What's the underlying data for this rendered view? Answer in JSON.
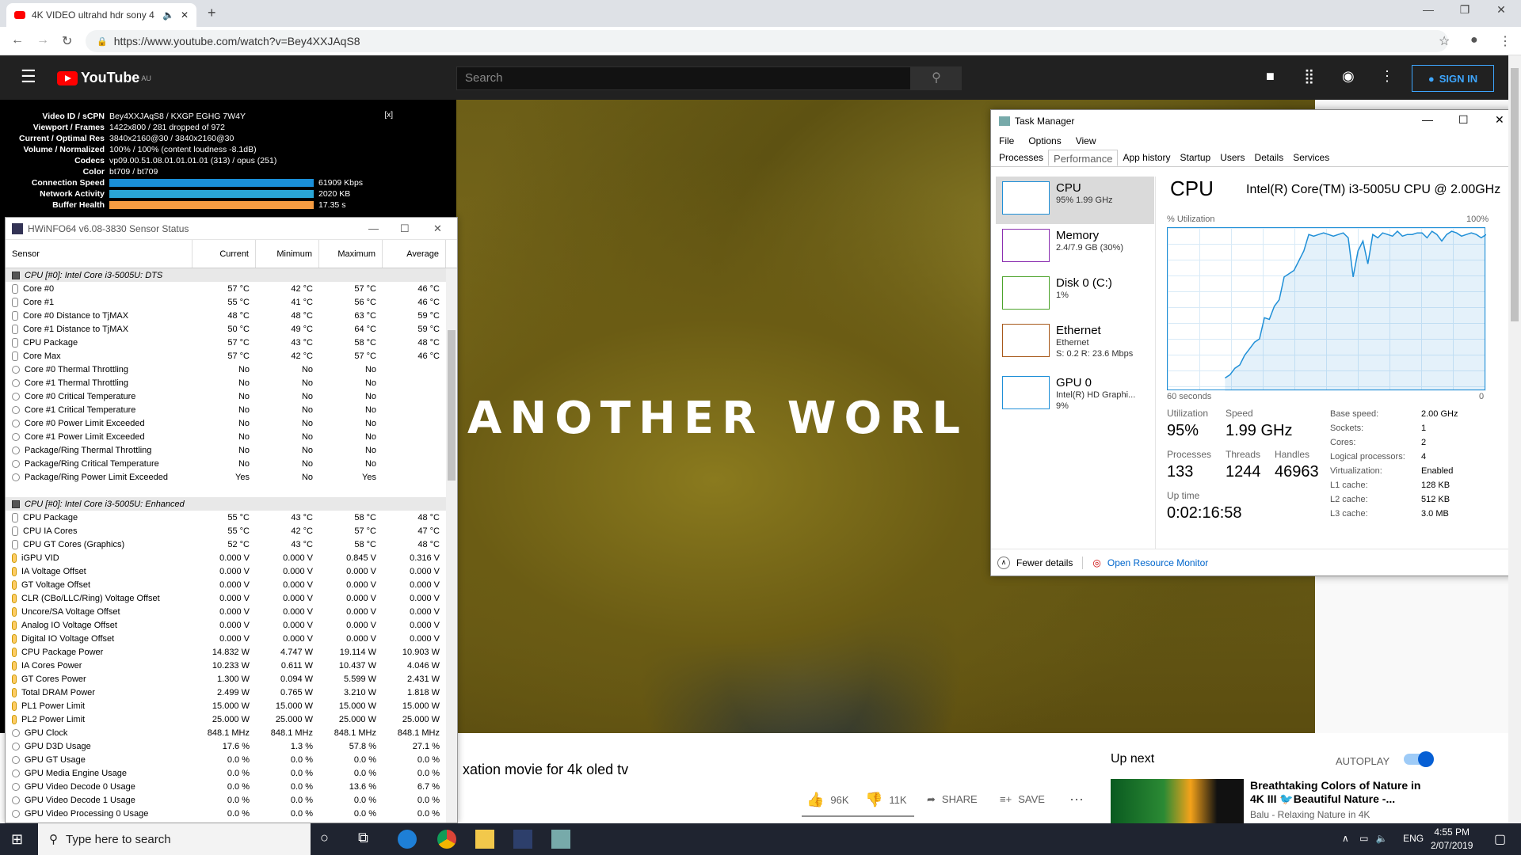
{
  "browser": {
    "tab_title": "4K VIDEO ultrahd hdr sony 4",
    "url": "https://www.youtube.com/watch?v=Bey4XXJAqS8"
  },
  "youtube": {
    "logo": "YouTube",
    "region": "AU",
    "search_placeholder": "Search",
    "sign_in": "SIGN IN",
    "video_overlay_text": "ANOTHER WORL",
    "video_title_visible": "xation movie for 4k oled tv",
    "likes": "96K",
    "dislikes": "11K",
    "share": "SHARE",
    "save": "SAVE",
    "up_next": "Up next",
    "autoplay": "AUTOPLAY",
    "next_title": "Breathtaking Colors of Nature in 4K III 🐦Beautiful Nature -...",
    "next_channel": "Balu - Relaxing Nature in 4K"
  },
  "stats": {
    "close": "[x]",
    "rows": [
      {
        "k": "Video ID / sCPN",
        "v": "Bey4XXJAqS8 / KXGP EGHG 7W4Y"
      },
      {
        "k": "Viewport / Frames",
        "v": "1422x800 / 281 dropped of 972"
      },
      {
        "k": "Current / Optimal Res",
        "v": "3840x2160@30 / 3840x2160@30"
      },
      {
        "k": "Volume / Normalized",
        "v": "100% / 100% (content loudness -8.1dB)"
      },
      {
        "k": "Codecs",
        "v": "vp09.00.51.08.01.01.01.01 (313) / opus (251)"
      },
      {
        "k": "Color",
        "v": "bt709 / bt709"
      }
    ],
    "bars": [
      {
        "k": "Connection Speed",
        "v": "61909 Kbps",
        "color": "#1a8fd8"
      },
      {
        "k": "Network Activity",
        "v": "2020 KB",
        "color": "#2aa6d6"
      },
      {
        "k": "Buffer Health",
        "v": "17.35 s",
        "color": "#f59c42"
      }
    ]
  },
  "hwinfo": {
    "title": "HWiNFO64 v6.08-3830 Sensor Status",
    "headers": [
      "Sensor",
      "Current",
      "Minimum",
      "Maximum",
      "Average"
    ],
    "rows": [
      {
        "t": "grp",
        "n": "CPU [#0]: Intel Core i3-5005U: DTS"
      },
      {
        "t": "temp",
        "n": "Core #0",
        "c": "57 °C",
        "mi": "42 °C",
        "ma": "57 °C",
        "av": "46 °C"
      },
      {
        "t": "temp",
        "n": "Core #1",
        "c": "55 °C",
        "mi": "41 °C",
        "ma": "56 °C",
        "av": "46 °C"
      },
      {
        "t": "temp",
        "n": "Core #0 Distance to TjMAX",
        "c": "48 °C",
        "mi": "48 °C",
        "ma": "63 °C",
        "av": "59 °C"
      },
      {
        "t": "temp",
        "n": "Core #1 Distance to TjMAX",
        "c": "50 °C",
        "mi": "49 °C",
        "ma": "64 °C",
        "av": "59 °C"
      },
      {
        "t": "temp",
        "n": "CPU Package",
        "c": "57 °C",
        "mi": "43 °C",
        "ma": "58 °C",
        "av": "48 °C"
      },
      {
        "t": "temp",
        "n": "Core Max",
        "c": "57 °C",
        "mi": "42 °C",
        "ma": "57 °C",
        "av": "46 °C"
      },
      {
        "t": "circ",
        "n": "Core #0 Thermal Throttling",
        "c": "No",
        "mi": "No",
        "ma": "No",
        "av": ""
      },
      {
        "t": "circ",
        "n": "Core #1 Thermal Throttling",
        "c": "No",
        "mi": "No",
        "ma": "No",
        "av": ""
      },
      {
        "t": "circ",
        "n": "Core #0 Critical Temperature",
        "c": "No",
        "mi": "No",
        "ma": "No",
        "av": ""
      },
      {
        "t": "circ",
        "n": "Core #1 Critical Temperature",
        "c": "No",
        "mi": "No",
        "ma": "No",
        "av": ""
      },
      {
        "t": "circ",
        "n": "Core #0 Power Limit Exceeded",
        "c": "No",
        "mi": "No",
        "ma": "No",
        "av": ""
      },
      {
        "t": "circ",
        "n": "Core #1 Power Limit Exceeded",
        "c": "No",
        "mi": "No",
        "ma": "No",
        "av": ""
      },
      {
        "t": "circ",
        "n": "Package/Ring Thermal Throttling",
        "c": "No",
        "mi": "No",
        "ma": "No",
        "av": ""
      },
      {
        "t": "circ",
        "n": "Package/Ring Critical Temperature",
        "c": "No",
        "mi": "No",
        "ma": "No",
        "av": ""
      },
      {
        "t": "circ",
        "n": "Package/Ring Power Limit Exceeded",
        "c": "Yes",
        "mi": "No",
        "ma": "Yes",
        "av": ""
      },
      {
        "t": "blank",
        "n": ""
      },
      {
        "t": "grp",
        "n": "CPU [#0]: Intel Core i3-5005U: Enhanced"
      },
      {
        "t": "temp",
        "n": "CPU Package",
        "c": "55 °C",
        "mi": "43 °C",
        "ma": "58 °C",
        "av": "48 °C"
      },
      {
        "t": "temp",
        "n": "CPU IA Cores",
        "c": "55 °C",
        "mi": "42 °C",
        "ma": "57 °C",
        "av": "47 °C"
      },
      {
        "t": "temp",
        "n": "CPU GT Cores (Graphics)",
        "c": "52 °C",
        "mi": "43 °C",
        "ma": "58 °C",
        "av": "48 °C"
      },
      {
        "t": "volt",
        "n": "iGPU VID",
        "c": "0.000 V",
        "mi": "0.000 V",
        "ma": "0.845 V",
        "av": "0.316 V"
      },
      {
        "t": "volt",
        "n": "IA Voltage Offset",
        "c": "0.000 V",
        "mi": "0.000 V",
        "ma": "0.000 V",
        "av": "0.000 V"
      },
      {
        "t": "volt",
        "n": "GT Voltage Offset",
        "c": "0.000 V",
        "mi": "0.000 V",
        "ma": "0.000 V",
        "av": "0.000 V"
      },
      {
        "t": "volt",
        "n": "CLR (CBo/LLC/Ring) Voltage Offset",
        "c": "0.000 V",
        "mi": "0.000 V",
        "ma": "0.000 V",
        "av": "0.000 V"
      },
      {
        "t": "volt",
        "n": "Uncore/SA Voltage Offset",
        "c": "0.000 V",
        "mi": "0.000 V",
        "ma": "0.000 V",
        "av": "0.000 V"
      },
      {
        "t": "volt",
        "n": "Analog IO Voltage Offset",
        "c": "0.000 V",
        "mi": "0.000 V",
        "ma": "0.000 V",
        "av": "0.000 V"
      },
      {
        "t": "volt",
        "n": "Digital IO Voltage Offset",
        "c": "0.000 V",
        "mi": "0.000 V",
        "ma": "0.000 V",
        "av": "0.000 V"
      },
      {
        "t": "volt",
        "n": "CPU Package Power",
        "c": "14.832 W",
        "mi": "4.747 W",
        "ma": "19.114 W",
        "av": "10.903 W"
      },
      {
        "t": "volt",
        "n": "IA Cores Power",
        "c": "10.233 W",
        "mi": "0.611 W",
        "ma": "10.437 W",
        "av": "4.046 W"
      },
      {
        "t": "volt",
        "n": "GT Cores Power",
        "c": "1.300 W",
        "mi": "0.094 W",
        "ma": "5.599 W",
        "av": "2.431 W"
      },
      {
        "t": "volt",
        "n": "Total DRAM Power",
        "c": "2.499 W",
        "mi": "0.765 W",
        "ma": "3.210 W",
        "av": "1.818 W"
      },
      {
        "t": "volt",
        "n": "PL1 Power Limit",
        "c": "15.000 W",
        "mi": "15.000 W",
        "ma": "15.000 W",
        "av": "15.000 W"
      },
      {
        "t": "volt",
        "n": "PL2 Power Limit",
        "c": "25.000 W",
        "mi": "25.000 W",
        "ma": "25.000 W",
        "av": "25.000 W"
      },
      {
        "t": "circ",
        "n": "GPU Clock",
        "c": "848.1 MHz",
        "mi": "848.1 MHz",
        "ma": "848.1 MHz",
        "av": "848.1 MHz"
      },
      {
        "t": "circ",
        "n": "GPU D3D Usage",
        "c": "17.6 %",
        "mi": "1.3 %",
        "ma": "57.8 %",
        "av": "27.1 %"
      },
      {
        "t": "circ",
        "n": "GPU GT Usage",
        "c": "0.0 %",
        "mi": "0.0 %",
        "ma": "0.0 %",
        "av": "0.0 %"
      },
      {
        "t": "circ",
        "n": "GPU Media Engine Usage",
        "c": "0.0 %",
        "mi": "0.0 %",
        "ma": "0.0 %",
        "av": "0.0 %"
      },
      {
        "t": "circ",
        "n": "GPU Video Decode 0 Usage",
        "c": "0.0 %",
        "mi": "0.0 %",
        "ma": "13.6 %",
        "av": "6.7 %"
      },
      {
        "t": "circ",
        "n": "GPU Video Decode 1 Usage",
        "c": "0.0 %",
        "mi": "0.0 %",
        "ma": "0.0 %",
        "av": "0.0 %"
      },
      {
        "t": "circ",
        "n": "GPU Video Processing 0 Usage",
        "c": "0.0 %",
        "mi": "0.0 %",
        "ma": "0.0 %",
        "av": "0.0 %"
      }
    ]
  },
  "taskmgr": {
    "title": "Task Manager",
    "menu": [
      "File",
      "Options",
      "View"
    ],
    "tabs": [
      "Processes",
      "Performance",
      "App history",
      "Startup",
      "Users",
      "Details",
      "Services"
    ],
    "resources": [
      {
        "name": "CPU",
        "sub1": "95% 1.99 GHz",
        "sub2": "",
        "color": "#1f8fd7"
      },
      {
        "name": "Memory",
        "sub1": "2.4/7.9 GB (30%)",
        "sub2": "",
        "color": "#8b2fb0"
      },
      {
        "name": "Disk 0 (C:)",
        "sub1": "1%",
        "sub2": "",
        "color": "#4ca32b"
      },
      {
        "name": "Ethernet",
        "sub1": "Ethernet",
        "sub2": "S: 0.2 R: 23.6 Mbps",
        "color": "#a7581a"
      },
      {
        "name": "GPU 0",
        "sub1": "Intel(R) HD Graphi...",
        "sub2": "9%",
        "color": "#1f8fd7"
      }
    ],
    "cpu_label": "CPU",
    "cpu_model": "Intel(R) Core(TM) i3-5005U CPU @ 2.00GHz",
    "util_label": "% Utilization",
    "util_max": "100%",
    "time_label": "60 seconds",
    "zero": "0",
    "stats": {
      "utilization_label": "Utilization",
      "utilization": "95%",
      "speed_label": "Speed",
      "speed": "1.99 GHz",
      "processes_label": "Processes",
      "processes": "133",
      "threads_label": "Threads",
      "threads": "1244",
      "handles_label": "Handles",
      "handles": "46963",
      "uptime_label": "Up time",
      "uptime": "0:02:16:58"
    },
    "specs": [
      {
        "k": "Base speed:",
        "v": "2.00 GHz"
      },
      {
        "k": "Sockets:",
        "v": "1"
      },
      {
        "k": "Cores:",
        "v": "2"
      },
      {
        "k": "Logical processors:",
        "v": "4"
      },
      {
        "k": "Virtualization:",
        "v": "Enabled"
      },
      {
        "k": "L1 cache:",
        "v": "128 KB"
      },
      {
        "k": "L2 cache:",
        "v": "512 KB"
      },
      {
        "k": "L3 cache:",
        "v": "3.0 MB"
      }
    ],
    "fewer_details": "Fewer details",
    "open_resmon": "Open Resource Monitor",
    "cpu_history": [
      8,
      10,
      14,
      16,
      22,
      26,
      30,
      32,
      45,
      44,
      52,
      56,
      70,
      72,
      74,
      80,
      86,
      96,
      95,
      96,
      97,
      96,
      95,
      96,
      97,
      94,
      70,
      86,
      92,
      78,
      96,
      94,
      97,
      96,
      95,
      98,
      95,
      96,
      96,
      97,
      97,
      94,
      98,
      96,
      92,
      96,
      98,
      97,
      95,
      96,
      97,
      96,
      94,
      96
    ]
  },
  "taskbar": {
    "search": "Type here to search",
    "lang": "ENG",
    "time": "4:55 PM",
    "date": "2/07/2019"
  }
}
